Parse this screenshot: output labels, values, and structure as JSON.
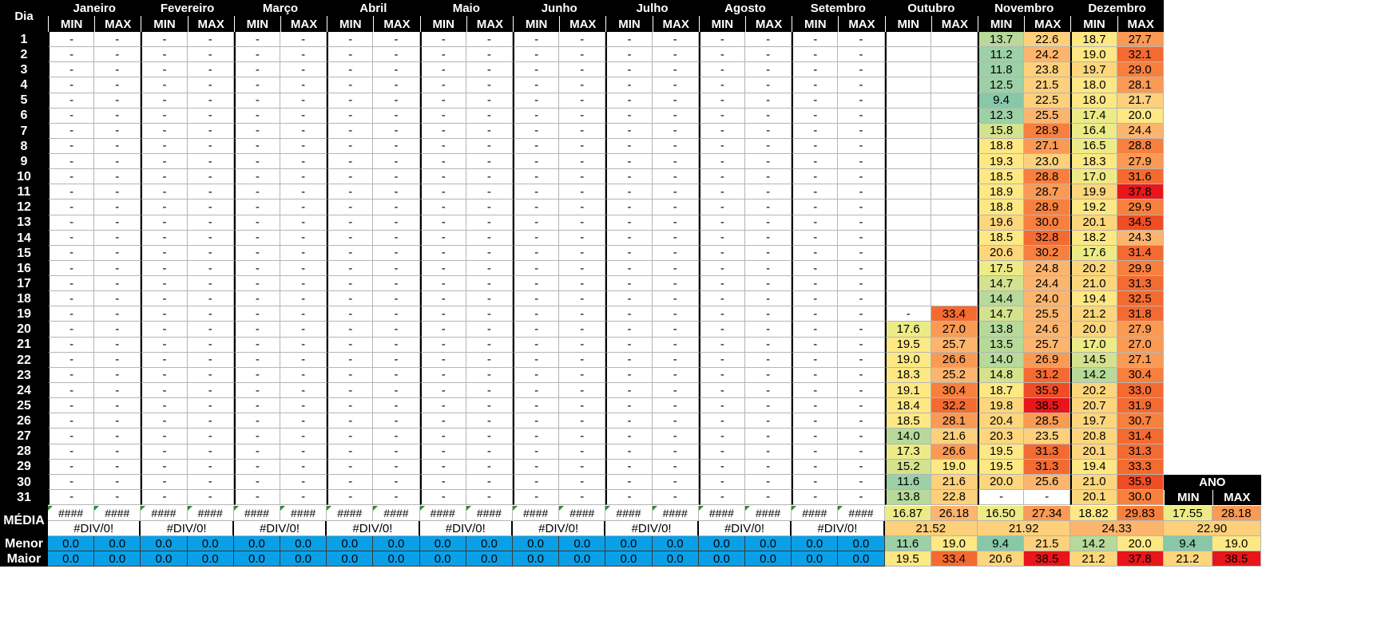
{
  "header": {
    "dia_label": "Dia",
    "min_label": "MIN",
    "max_label": "MAX",
    "ano_label": "ANO",
    "media_label": "MÉDIA",
    "menor_label": "Menor",
    "maior_label": "Maior"
  },
  "months": [
    "Janeiro",
    "Fevereiro",
    "Março",
    "Abril",
    "Maio",
    "Junho",
    "Julho",
    "Agosto",
    "Setembro",
    "Outubro",
    "Novembro",
    "Dezembro"
  ],
  "empty_value": "-",
  "days": [
    "1",
    "2",
    "3",
    "4",
    "5",
    "6",
    "7",
    "8",
    "9",
    "10",
    "11",
    "12",
    "13",
    "14",
    "15",
    "16",
    "17",
    "18",
    "19",
    "20",
    "21",
    "22",
    "23",
    "24",
    "25",
    "26",
    "27",
    "28",
    "29",
    "30",
    "31"
  ],
  "october": {
    "min": [
      "",
      "",
      "",
      "",
      "",
      "",
      "",
      "",
      "",
      "",
      "",
      "",
      "",
      "",
      "",
      "",
      "",
      "",
      "-",
      "17.6",
      "19.5",
      "19.0",
      "18.3",
      "19.1",
      "18.4",
      "18.5",
      "14.0",
      "17.3",
      "15.2",
      "11.6",
      "13.8"
    ],
    "max": [
      "",
      "",
      "",
      "",
      "",
      "",
      "",
      "",
      "",
      "",
      "",
      "",
      "",
      "",
      "",
      "",
      "",
      "",
      "33.4",
      "27.0",
      "25.7",
      "26.6",
      "25.2",
      "30.4",
      "32.2",
      "28.1",
      "21.6",
      "26.6",
      "19.0",
      "21.6",
      "22.8"
    ]
  },
  "november": {
    "min": [
      "13.7",
      "11.2",
      "11.8",
      "12.5",
      "9.4",
      "12.3",
      "15.8",
      "18.8",
      "19.3",
      "18.5",
      "18.9",
      "18.8",
      "19.6",
      "18.5",
      "20.6",
      "17.5",
      "14.7",
      "14.4",
      "14.7",
      "13.8",
      "13.5",
      "14.0",
      "14.8",
      "18.7",
      "19.8",
      "20.4",
      "20.3",
      "19.5",
      "19.5",
      "20.0",
      "-"
    ],
    "max": [
      "22.6",
      "24.2",
      "23.8",
      "21.5",
      "22.5",
      "25.5",
      "28.9",
      "27.1",
      "23.0",
      "28.8",
      "28.7",
      "28.9",
      "30.0",
      "32.8",
      "30.2",
      "24.8",
      "24.4",
      "24.0",
      "25.5",
      "24.6",
      "25.7",
      "26.9",
      "31.2",
      "35.9",
      "38.5",
      "28.5",
      "23.5",
      "31.3",
      "31.3",
      "25.6",
      "-"
    ]
  },
  "december": {
    "min": [
      "18.7",
      "19.0",
      "19.7",
      "18.0",
      "18.0",
      "17.4",
      "16.4",
      "16.5",
      "18.3",
      "17.0",
      "19.9",
      "19.2",
      "20.1",
      "18.2",
      "17.6",
      "20.2",
      "21.0",
      "19.4",
      "21.2",
      "20.0",
      "17.0",
      "14.5",
      "14.2",
      "20.2",
      "20.7",
      "19.7",
      "20.8",
      "20.1",
      "19.4",
      "21.0",
      "20.1"
    ],
    "max": [
      "27.7",
      "32.1",
      "29.0",
      "28.1",
      "21.7",
      "20.0",
      "24.4",
      "28.8",
      "27.9",
      "31.6",
      "37.8",
      "29.9",
      "34.5",
      "24.3",
      "31.4",
      "29.9",
      "31.3",
      "32.5",
      "31.8",
      "27.9",
      "27.0",
      "27.1",
      "30.4",
      "33.0",
      "31.9",
      "30.7",
      "31.4",
      "31.3",
      "33.3",
      "35.9",
      "30.0"
    ]
  },
  "summary": {
    "hash_text": "####",
    "div_text": "#DIV/0!",
    "zero_text": "0.0",
    "october": {
      "media_min": "16.87",
      "media_max": "26.18",
      "media": "21.52",
      "menor_min": "11.6",
      "menor_max": "19.0",
      "maior_min": "19.5",
      "maior_max": "33.4"
    },
    "november": {
      "media_min": "16.50",
      "media_max": "27.34",
      "media": "21.92",
      "menor_min": "9.4",
      "menor_max": "21.5",
      "maior_min": "20.6",
      "maior_max": "38.5"
    },
    "december": {
      "media_min": "18.82",
      "media_max": "29.83",
      "media": "24.33",
      "menor_min": "14.2",
      "menor_max": "20.0",
      "maior_min": "21.2",
      "maior_max": "37.8"
    },
    "ano": {
      "media_min": "17.55",
      "media_max": "28.18",
      "media": "22.90",
      "menor_min": "9.4",
      "menor_max": "19.0",
      "maior_min": "21.2",
      "maior_max": "38.5"
    }
  },
  "heatmap_colors": {
    "min_scale": [
      "#86c8a8",
      "#9cd0a6",
      "#b7d99a",
      "#d4e28e",
      "#edeb86",
      "#fde884",
      "#fdd67c"
    ],
    "max_scale": [
      "#fde884",
      "#fdd07c",
      "#fcb56e",
      "#f99a55",
      "#f7803e",
      "#f46b32",
      "#ee4d25",
      "#e8161a"
    ]
  }
}
